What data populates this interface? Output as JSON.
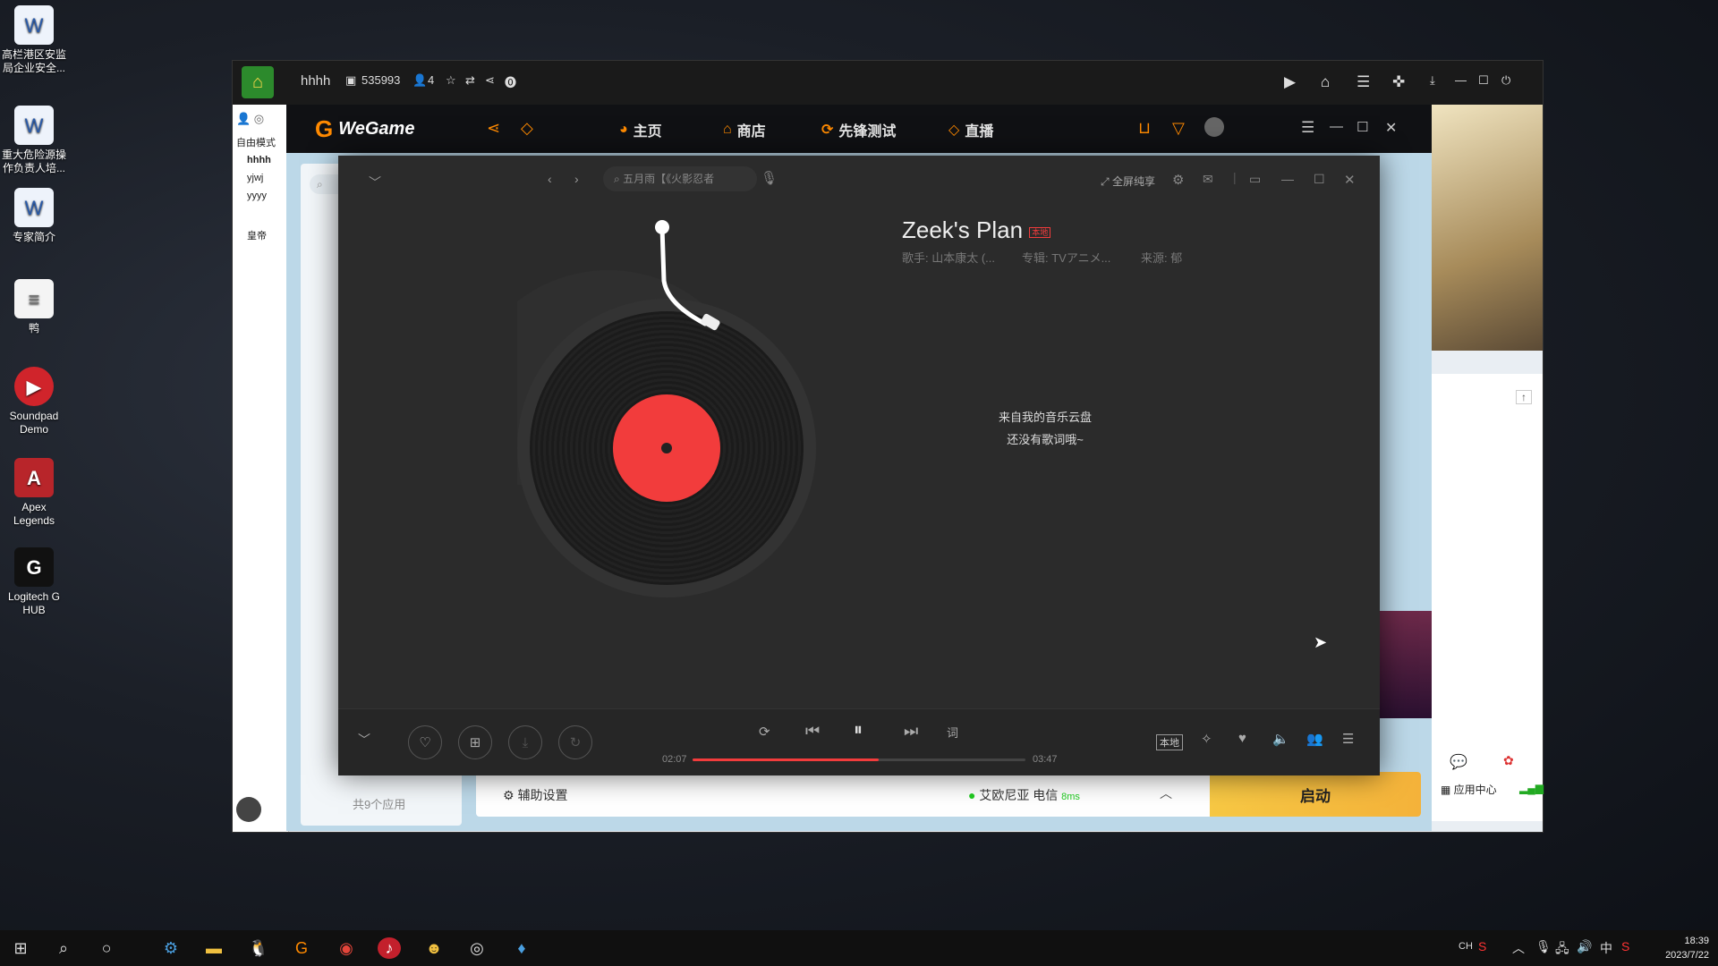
{
  "desktop_icons": [
    {
      "label": "高栏港区安监局企业安全..."
    },
    {
      "label": "重大危险源操作负责人培..."
    },
    {
      "label": "专家简介"
    },
    {
      "label": "鸭"
    },
    {
      "label": "Soundpad Demo"
    },
    {
      "label": "Apex Legends"
    },
    {
      "label": "Logitech G HUB"
    }
  ],
  "qq": {
    "name": "hhhh",
    "score": "535993",
    "members": "4",
    "sidebar": {
      "mode": "自由模式",
      "items": [
        "hhhh",
        "yjwj",
        "yyyy",
        "皇帝"
      ]
    }
  },
  "wegame": {
    "logo": "WeGame",
    "nav": [
      "主页",
      "商店",
      "先锋测试",
      "直播"
    ],
    "search_placeholder": "搜索",
    "apps_count": "共9个应用",
    "assist": "辅助设置",
    "server": "艾欧尼亚 电信",
    "ping": "8ms",
    "launch": "启动",
    "app_center": "应用中心"
  },
  "player": {
    "search_placeholder": "五月雨【《火影忍者",
    "fullscreen": "全屏纯享",
    "song_title": "Zeek's Plan",
    "badge": "本地",
    "singer": "歌手: 山本康太 (...",
    "album": "专辑: TVアニメ...",
    "source": "来源: 郁",
    "lyric_line1": "来自我的音乐云盘",
    "lyric_line2": "还没有歌词哦~",
    "time_current": "02:07",
    "time_total": "03:47",
    "progress": 0.56,
    "local_label": "本地",
    "lyric_btn": "词"
  },
  "taskbar": {
    "ime1": "CH",
    "ime2": "中",
    "time": "18:39",
    "date": "2023/7/22"
  },
  "colors": {
    "accent_red": "#f23c3c",
    "wegame_orange": "#ff8a00",
    "launch_yellow": "#f7c844"
  }
}
